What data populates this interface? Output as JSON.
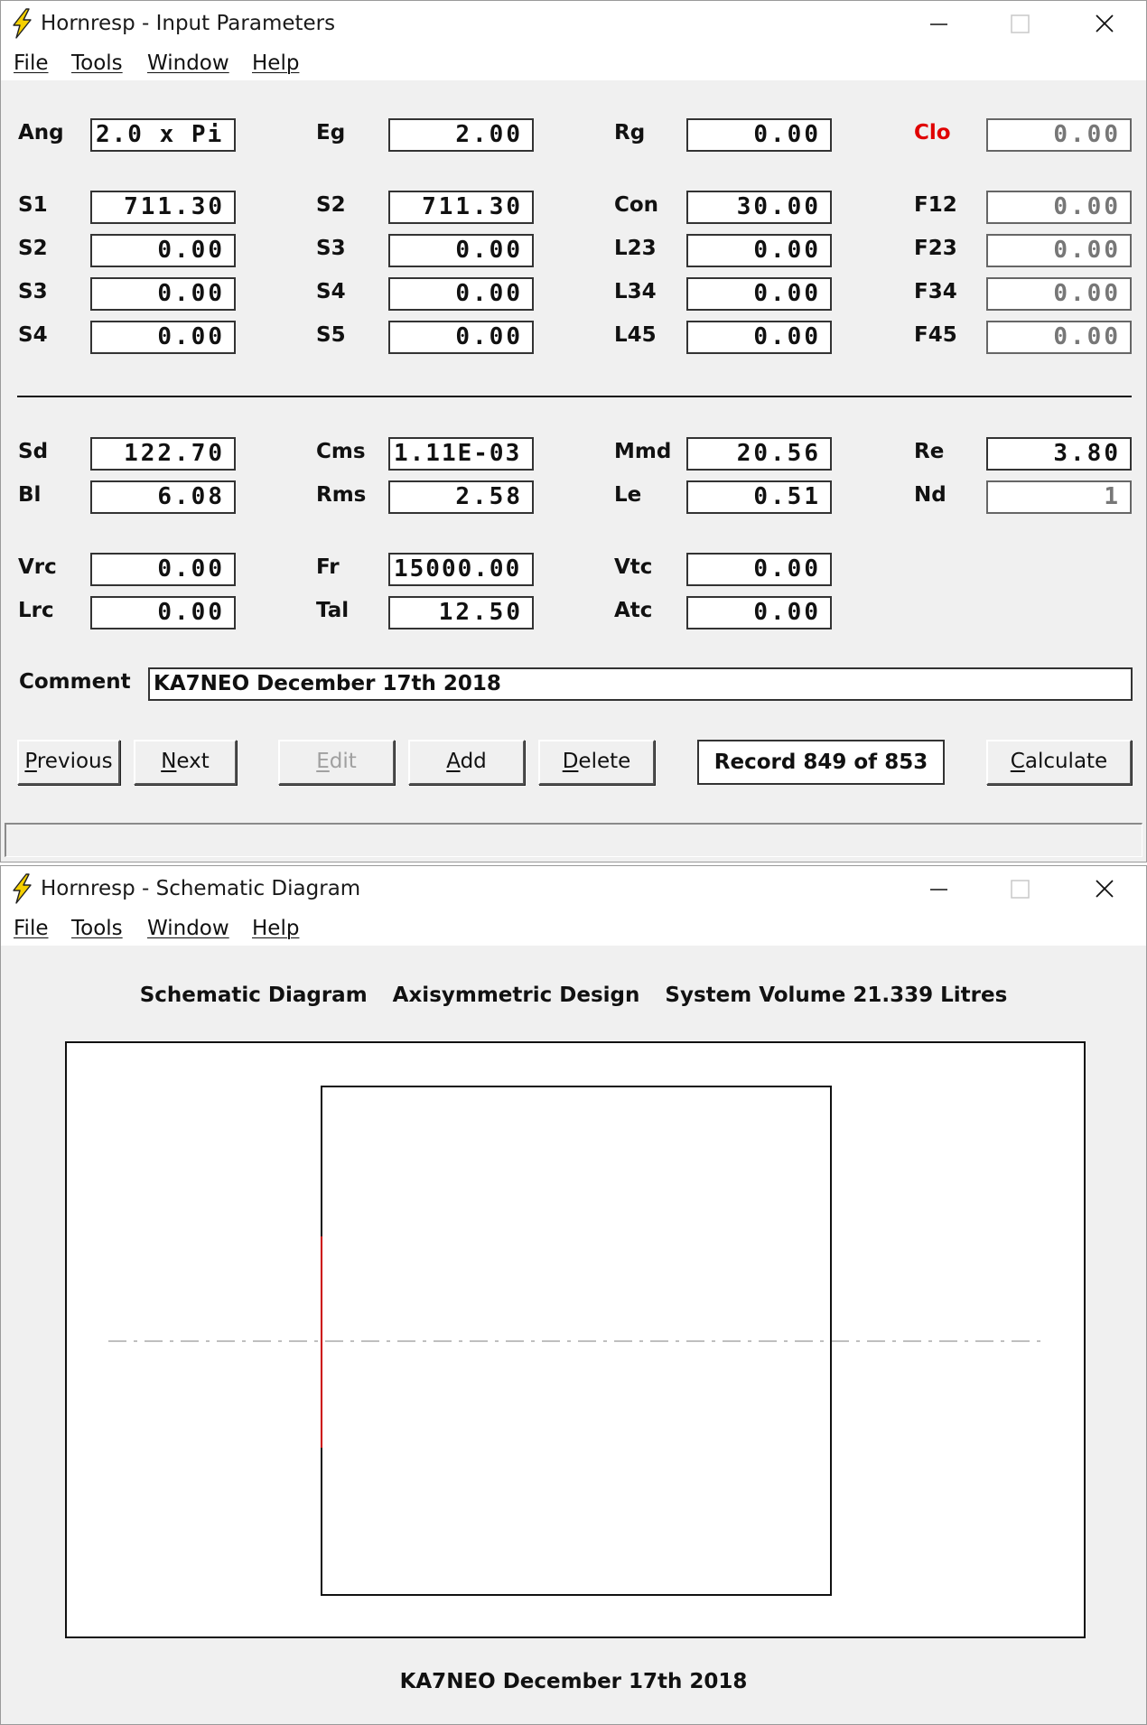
{
  "input_window": {
    "title": "Hornresp - Input Parameters",
    "menu": [
      "File",
      "Tools",
      "Window",
      "Help"
    ],
    "top_params": [
      {
        "label": "Ang",
        "value": "2.0 x Pi"
      },
      {
        "label": "Eg",
        "value": "2.00"
      },
      {
        "label": "Rg",
        "value": "0.00"
      },
      {
        "label": "Clo",
        "value": "0.00"
      }
    ],
    "horn_params": [
      {
        "label": "S1",
        "value": "711.30"
      },
      {
        "label": "S2",
        "value": "711.30"
      },
      {
        "label": "Con",
        "value": "30.00"
      },
      {
        "label": "F12",
        "value": "0.00"
      },
      {
        "label": "S2",
        "value": "0.00"
      },
      {
        "label": "S3",
        "value": "0.00"
      },
      {
        "label": "L23",
        "value": "0.00"
      },
      {
        "label": "F23",
        "value": "0.00"
      },
      {
        "label": "S3",
        "value": "0.00"
      },
      {
        "label": "S4",
        "value": "0.00"
      },
      {
        "label": "L34",
        "value": "0.00"
      },
      {
        "label": "F34",
        "value": "0.00"
      },
      {
        "label": "S4",
        "value": "0.00"
      },
      {
        "label": "S5",
        "value": "0.00"
      },
      {
        "label": "L45",
        "value": "0.00"
      },
      {
        "label": "F45",
        "value": "0.00"
      }
    ],
    "driver_params": [
      {
        "label": "Sd",
        "value": "122.70"
      },
      {
        "label": "Cms",
        "value": "1.11E-03"
      },
      {
        "label": "Mmd",
        "value": "20.56"
      },
      {
        "label": "Re",
        "value": "3.80"
      },
      {
        "label": "Bl",
        "value": "6.08"
      },
      {
        "label": "Rms",
        "value": "2.58"
      },
      {
        "label": "Le",
        "value": "0.51"
      },
      {
        "label": "Nd",
        "value": "1"
      }
    ],
    "chamber_params": [
      {
        "label": "Vrc",
        "value": "0.00"
      },
      {
        "label": "Fr",
        "value": "15000.00"
      },
      {
        "label": "Vtc",
        "value": "0.00"
      },
      {
        "label": "Lrc",
        "value": "0.00"
      },
      {
        "label": "Tal",
        "value": "12.50"
      },
      {
        "label": "Atc",
        "value": "0.00"
      }
    ],
    "comment_label": "Comment",
    "comment_value": "KA7NEO December 17th 2018",
    "buttons": {
      "previous": {
        "first": "P",
        "rest": "revious"
      },
      "next": {
        "first": "N",
        "rest": "ext"
      },
      "edit": {
        "first": "E",
        "rest": "dit"
      },
      "add": {
        "first": "A",
        "rest": "dd"
      },
      "delete": {
        "first": "D",
        "rest": "elete"
      },
      "calculate": {
        "first": "C",
        "rest": "alculate"
      }
    },
    "record_text": "Record 849 of 853",
    "status_text": ""
  },
  "schematic_window": {
    "title": "Hornresp - Schematic Diagram",
    "menu": [
      "File",
      "Tools",
      "Window",
      "Help"
    ],
    "header": [
      "Schematic Diagram",
      "Axisymmetric Design",
      "System Volume 21.339 Litres"
    ],
    "footer": "KA7NEO December 17th 2018"
  },
  "colors": {
    "label_alert": "#e00000",
    "driver_line": "#cc0000",
    "axis_line": "#aaaaaa",
    "window_bg": "#f0f0f0"
  }
}
